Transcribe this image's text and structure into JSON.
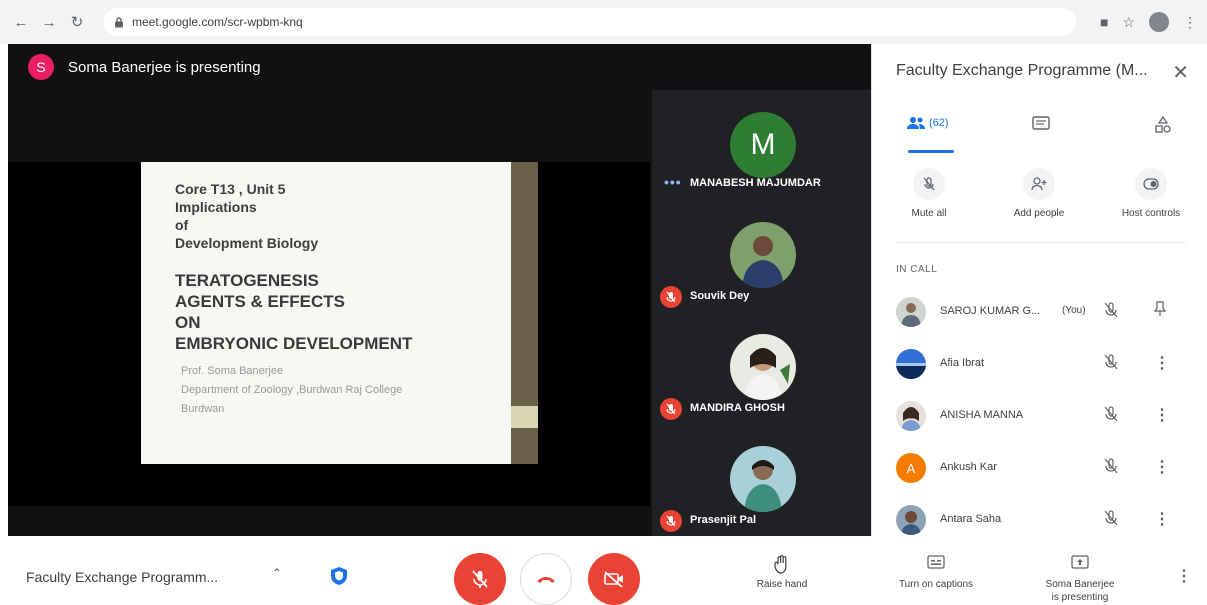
{
  "browser": {
    "url": "meet.google.com/scr-wpbm-knq"
  },
  "presenting_banner": {
    "avatar_letter": "S",
    "text": "Soma Banerjee is presenting"
  },
  "slide": {
    "lines": [
      "Core T13 , Unit 5",
      "Implications",
      "of",
      "Development Biology"
    ],
    "headline": [
      "TERATOGENESIS",
      "AGENTS & EFFECTS",
      "ON",
      "EMBRYONIC DEVELOPMENT"
    ],
    "credits": [
      "Prof. Soma Banerjee",
      "Department of Zoology ,Burdwan Raj College",
      "Burdwan"
    ]
  },
  "tiles": [
    {
      "name": "MANABESH MAJUMDAR",
      "avatar_letter": "M"
    },
    {
      "name": "Souvik Dey"
    },
    {
      "name": "MANDIRA GHOSH"
    },
    {
      "name": "Prasenjit Pal"
    }
  ],
  "panel": {
    "title": "Faculty Exchange Programme (M...",
    "people_count": "(62)",
    "actions": [
      {
        "label": "Mute all"
      },
      {
        "label": "Add people"
      },
      {
        "label": "Host controls"
      }
    ],
    "section_label": "IN CALL",
    "people": [
      {
        "name": "SAROJ KUMAR G...",
        "you": "(You)"
      },
      {
        "name": "Afia Ibrat"
      },
      {
        "name": "ANISHA MANNA"
      },
      {
        "name": "Ankush Kar",
        "initial": "A"
      },
      {
        "name": "Antara Saha"
      }
    ]
  },
  "bottombar": {
    "meeting_title": "Faculty Exchange Programm...",
    "raise_hand": "Raise hand",
    "captions": "Turn on captions",
    "presenting_line1": "Soma Banerjee",
    "presenting_line2": "is presenting"
  },
  "colors": {
    "mic_off_red": "#ea4335",
    "accent_blue": "#1a73e8",
    "avatar_pink": "#e91e63",
    "avatar_green": "#2e7d32",
    "avatar_orange": "#f57c00"
  }
}
